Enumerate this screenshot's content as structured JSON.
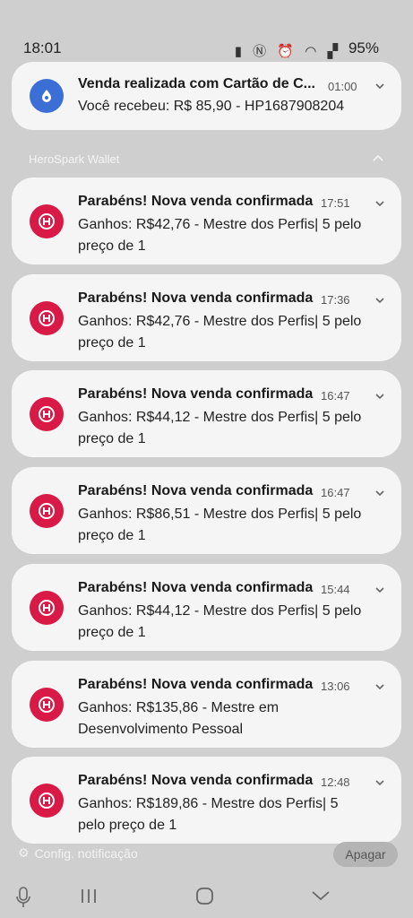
{
  "status_bar": {
    "time": "18:01",
    "icons": [
      "battery-saver-icon",
      "nfc-icon",
      "alarm-icon",
      "wifi-icon",
      "signal-icon"
    ],
    "battery": "95%"
  },
  "top_notification": {
    "title": "Venda realizada com Cartão de C...",
    "time": "01:00",
    "body": "Você recebeu: R$ 85,90 - HP1687908204",
    "icon_color": "#3b6fd6"
  },
  "group": {
    "app_name": "HeroSpark Wallet"
  },
  "notifications": [
    {
      "title": "Parabéns! Nova venda confirmada",
      "time": "17:51",
      "body": "Ganhos: R$42,76 - Mestre dos Perfis| 5 pelo preço de 1"
    },
    {
      "title": "Parabéns! Nova venda confirmada",
      "time": "17:36",
      "body": "Ganhos: R$42,76 - Mestre dos Perfis| 5 pelo preço de 1"
    },
    {
      "title": "Parabéns! Nova venda confirmada",
      "time": "16:47",
      "body": "Ganhos: R$44,12 - Mestre dos Perfis| 5 pelo preço de 1"
    },
    {
      "title": "Parabéns! Nova venda confirmada",
      "time": "16:47",
      "body": "Ganhos: R$86,51 - Mestre dos Perfis| 5 pelo preço de 1"
    },
    {
      "title": "Parabéns! Nova venda confirmada",
      "time": "15:44",
      "body": "Ganhos: R$44,12 - Mestre dos Perfis| 5 pelo preço de 1"
    },
    {
      "title": "Parabéns! Nova venda confirmada",
      "time": "13:06",
      "body": "Ganhos: R$135,86 - Mestre em Desenvolvimento Pessoal"
    },
    {
      "title": "Parabéns! Nova venda confirmada",
      "time": "12:48",
      "body": "Ganhos: R$189,86 - Mestre dos Perfis| 5 pelo preço de 1"
    }
  ],
  "footer": {
    "settings_label": "Config. notificação",
    "clear_label": "Apagar"
  },
  "colors": {
    "herospark_icon": "#d91a46",
    "background": "#cfcfcf",
    "card": "#f5f5f5"
  }
}
